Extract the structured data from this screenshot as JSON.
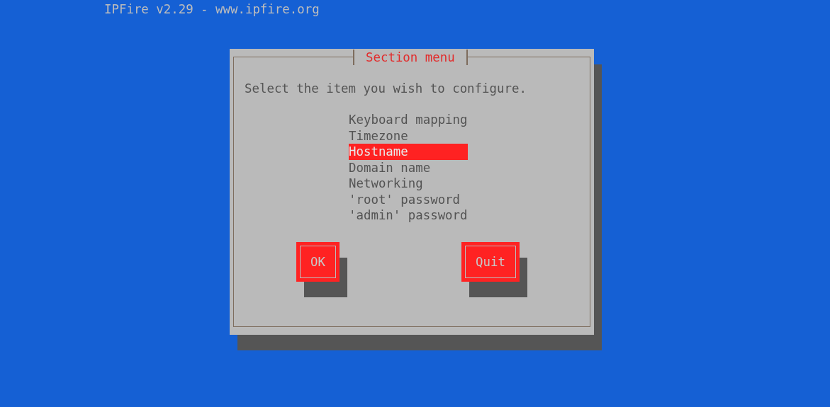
{
  "header": {
    "title": "IPFire v2.29 - www.ipfire.org"
  },
  "dialog": {
    "title": "Section menu",
    "prompt": "Select the item you wish to configure.",
    "items": [
      {
        "label": "Keyboard mapping",
        "selected": false
      },
      {
        "label": "Timezone",
        "selected": false
      },
      {
        "label": "Hostname",
        "selected": true
      },
      {
        "label": "Domain name",
        "selected": false
      },
      {
        "label": "Networking",
        "selected": false
      },
      {
        "label": "'root' password",
        "selected": false
      },
      {
        "label": "'admin' password",
        "selected": false
      }
    ],
    "buttons": [
      {
        "label": "OK"
      },
      {
        "label": "Quit"
      }
    ]
  }
}
